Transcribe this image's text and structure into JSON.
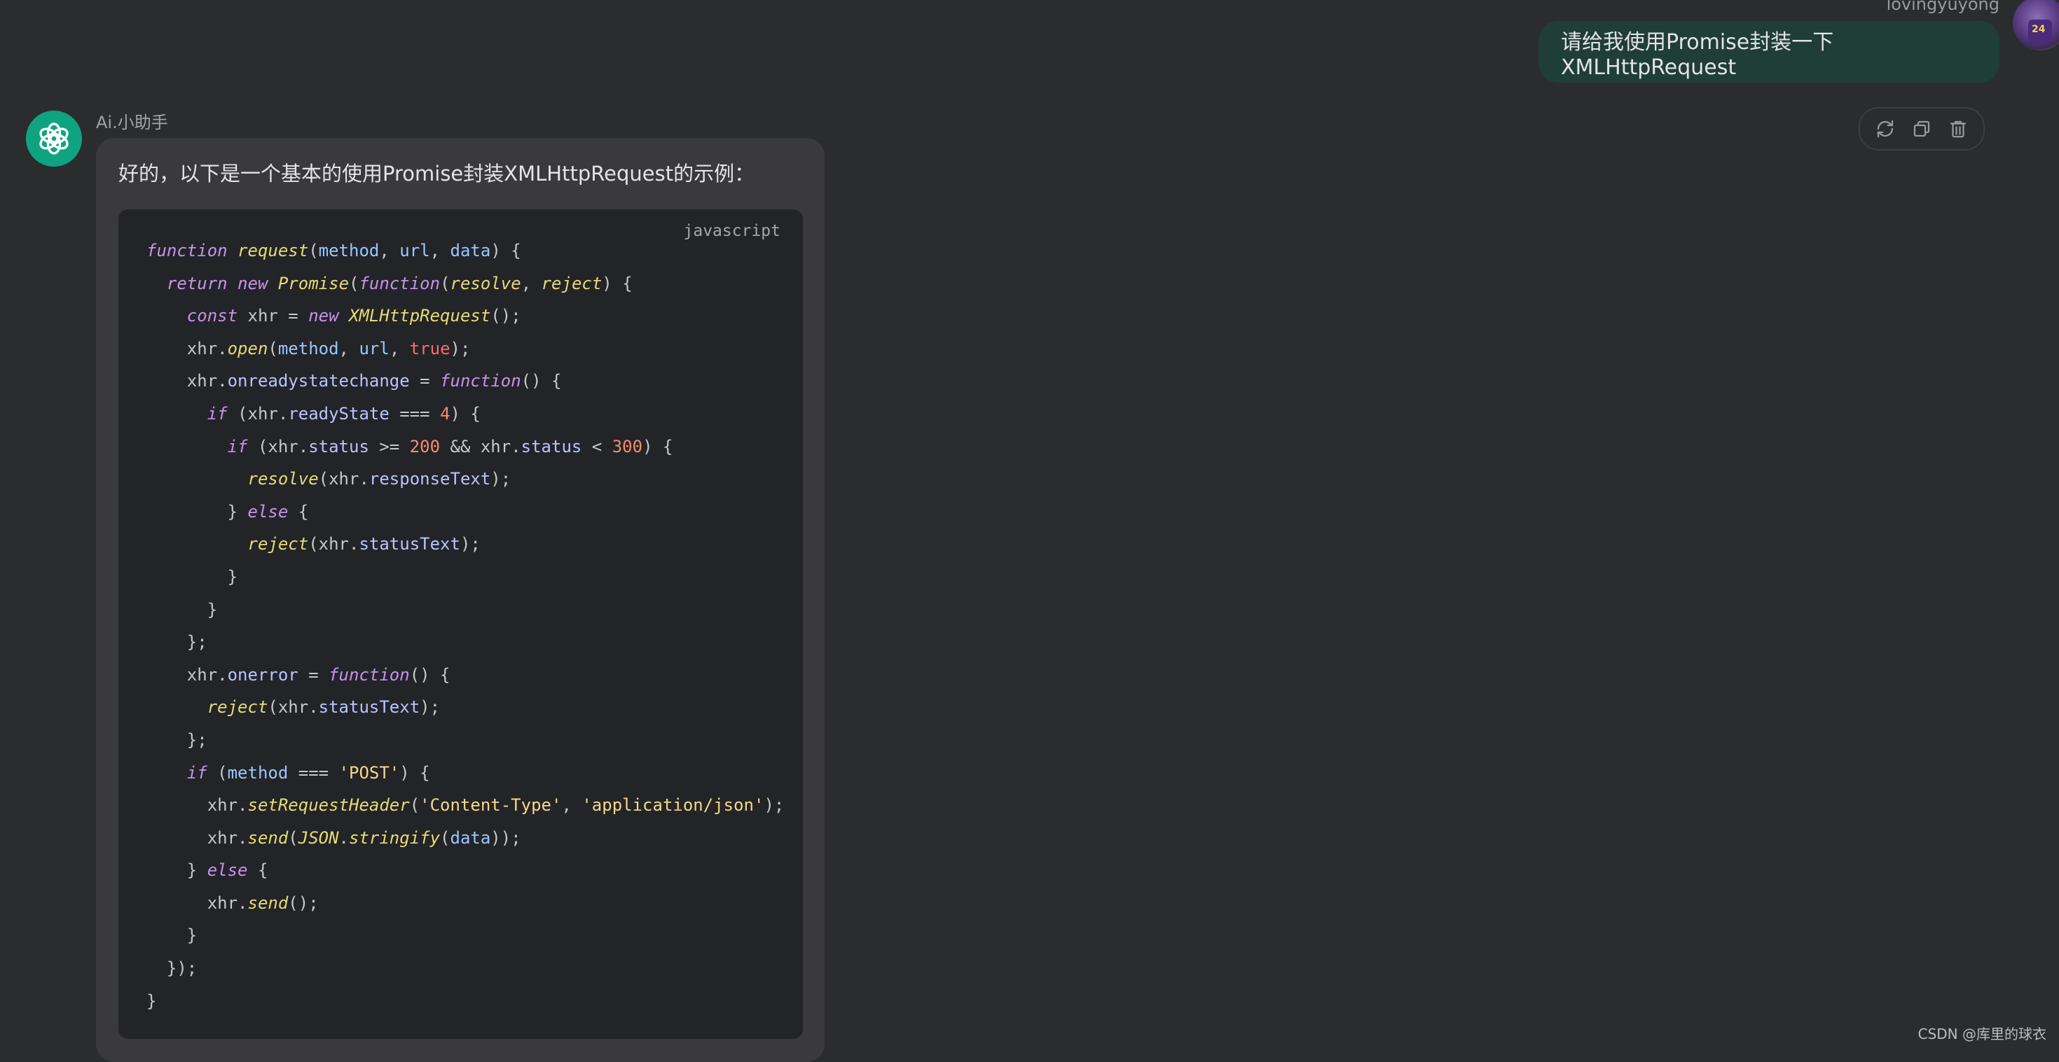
{
  "user": {
    "name": "lovingyuyong",
    "message": "请给我使用Promise封装一下 XMLHttpRequest",
    "avatar_number": "24"
  },
  "actions": {
    "icons": [
      "refresh-icon",
      "copy-icon",
      "trash-icon"
    ]
  },
  "assistant": {
    "name": "Ai.小助手",
    "intro": "好的，以下是一个基本的使用Promise封装XMLHttpRequest的示例：",
    "code_language": "javascript",
    "code_lines": [
      "function request(method, url, data) {",
      "  return new Promise(function(resolve, reject) {",
      "    const xhr = new XMLHttpRequest();",
      "    xhr.open(method, url, true);",
      "    xhr.onreadystatechange = function() {",
      "      if (xhr.readyState === 4) {",
      "        if (xhr.status >= 200 && xhr.status < 300) {",
      "          resolve(xhr.responseText);",
      "        } else {",
      "          reject(xhr.statusText);",
      "        }",
      "      }",
      "    };",
      "    xhr.onerror = function() {",
      "      reject(xhr.statusText);",
      "    };",
      "    if (method === 'POST') {",
      "      xhr.setRequestHeader('Content-Type', 'application/json');",
      "      xhr.send(JSON.stringify(data));",
      "    } else {",
      "      xhr.send();",
      "    }",
      "  });",
      "}"
    ]
  },
  "watermark": "CSDN @库里的球衣",
  "colors": {
    "background": "#2b2c2e",
    "user_bubble": "#1f3e36",
    "bot_bubble": "#3a3a3c",
    "code_bg": "#232428",
    "bot_avatar": "#10a37f"
  }
}
